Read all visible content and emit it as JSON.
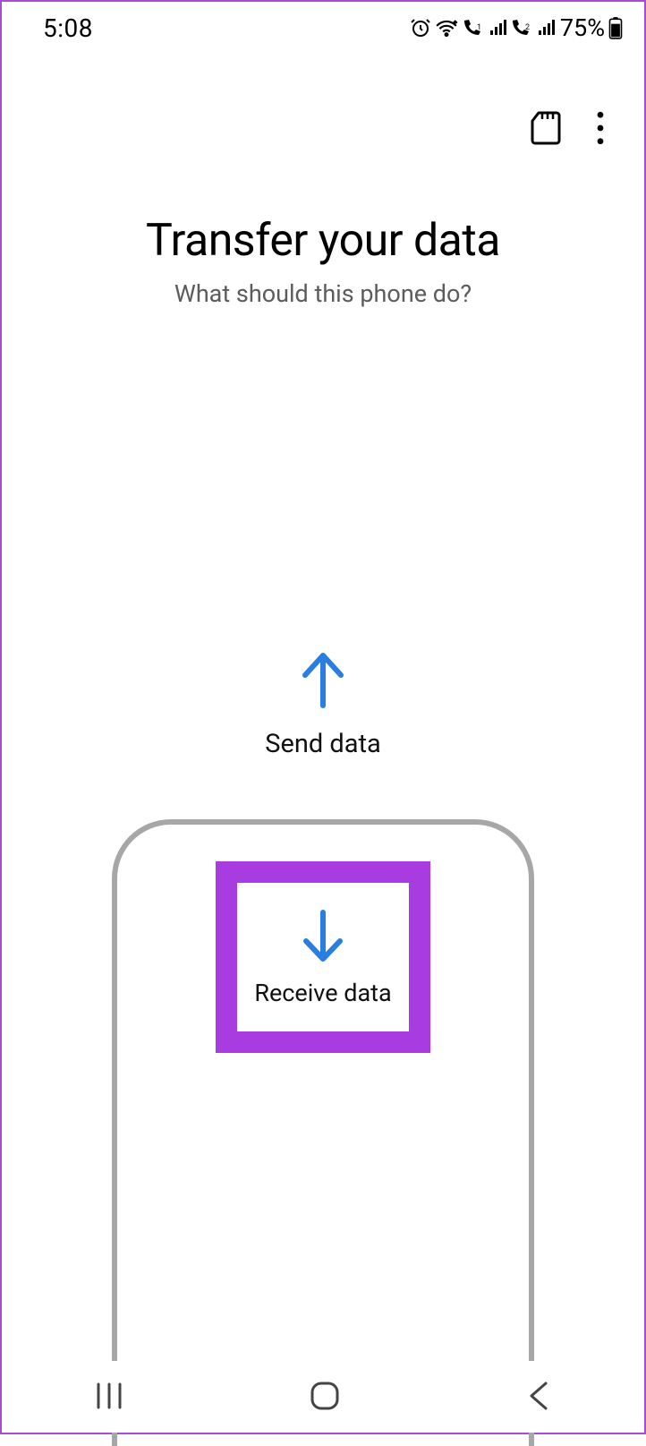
{
  "status": {
    "time": "5:08",
    "battery_text": "75%"
  },
  "appbar": {
    "sd_icon": "sd-card-icon",
    "more_icon": "more-icon"
  },
  "headings": {
    "title": "Transfer your data",
    "subtitle": "What should this phone do?"
  },
  "actions": {
    "send_label": "Send data",
    "receive_label": "Receive data"
  },
  "nav": {
    "recents": "recents",
    "home": "home",
    "back": "back"
  },
  "colors": {
    "accent_blue": "#2a7de1",
    "highlight_purple": "#a93ce0",
    "phone_border": "#a7a7a7"
  }
}
